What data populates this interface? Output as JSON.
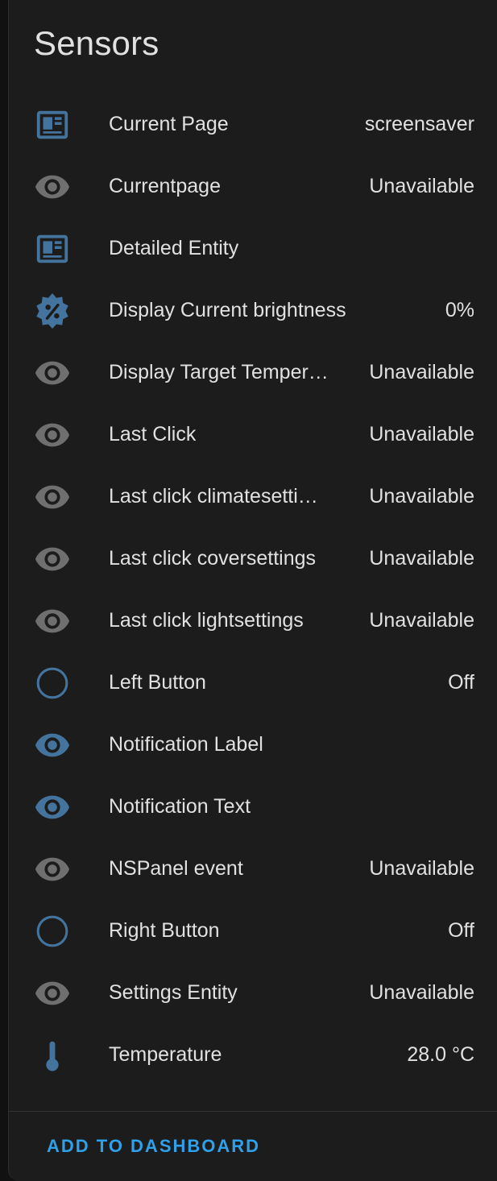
{
  "card": {
    "title": "Sensors"
  },
  "colors": {
    "active_icon": "#44739e",
    "inactive_icon": "#6f6f6f",
    "accent": "#2fa0ea",
    "text": "#e1e1e1",
    "card_bg": "#1c1c1c"
  },
  "entities": [
    {
      "name": "Current Page",
      "state": "screensaver",
      "icon": "card-text-icon",
      "active": true
    },
    {
      "name": "Currentpage",
      "state": "Unavailable",
      "icon": "eye-icon",
      "active": false
    },
    {
      "name": "Detailed Entity",
      "state": "",
      "icon": "card-text-icon",
      "active": true
    },
    {
      "name": "Display Current brightness",
      "state": "0%",
      "icon": "brightness-percent-icon",
      "active": true
    },
    {
      "name": "Display Target Temper…",
      "state": "Unavailable",
      "icon": "eye-icon",
      "active": false
    },
    {
      "name": "Last Click",
      "state": "Unavailable",
      "icon": "eye-icon",
      "active": false
    },
    {
      "name": "Last click climatesetti…",
      "state": "Unavailable",
      "icon": "eye-icon",
      "active": false
    },
    {
      "name": "Last click coversettings",
      "state": "Unavailable",
      "icon": "eye-icon",
      "active": false
    },
    {
      "name": "Last click lightsettings",
      "state": "Unavailable",
      "icon": "eye-icon",
      "active": false
    },
    {
      "name": "Left Button",
      "state": "Off",
      "icon": "circle-outline-icon",
      "active": true
    },
    {
      "name": "Notification Label",
      "state": "",
      "icon": "eye-icon",
      "active": true
    },
    {
      "name": "Notification Text",
      "state": "",
      "icon": "eye-icon",
      "active": true
    },
    {
      "name": "NSPanel event",
      "state": "Unavailable",
      "icon": "eye-icon",
      "active": false
    },
    {
      "name": "Right Button",
      "state": "Off",
      "icon": "circle-outline-icon",
      "active": true
    },
    {
      "name": "Settings Entity",
      "state": "Unavailable",
      "icon": "eye-icon",
      "active": false
    },
    {
      "name": "Temperature",
      "state": "28.0 °C",
      "icon": "thermometer-icon",
      "active": true
    }
  ],
  "footer": {
    "add_label": "ADD TO DASHBOARD"
  }
}
